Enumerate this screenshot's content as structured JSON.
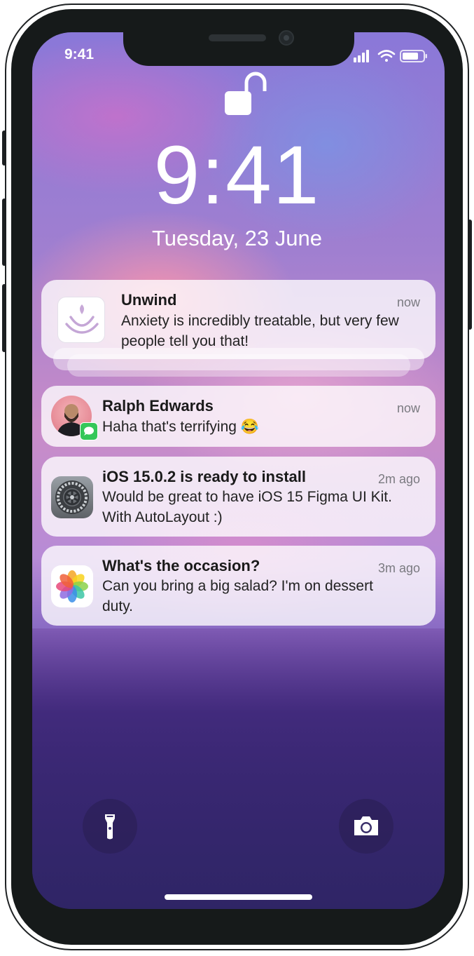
{
  "status_bar": {
    "time": "9:41",
    "icons": [
      "signal-bars-icon",
      "wifi-icon",
      "battery-icon"
    ]
  },
  "lock_screen": {
    "lock_icon": "unlocked-padlock-icon",
    "time": "9:41",
    "date": "Tuesday,  23 June"
  },
  "notifications": [
    {
      "app_icon": "unwind-app-icon",
      "title": "Unwind",
      "body": "Anxiety is incredibly treatable, but very few people tell you that!",
      "time": "now",
      "stacked": true
    },
    {
      "app_icon": "avatar-with-messages-badge",
      "title": "Ralph Edwards",
      "body": "Haha that's terrifying 😂",
      "time": "now"
    },
    {
      "app_icon": "settings-gear-icon",
      "title": "iOS 15.0.2 is ready to install",
      "body": "Would be great to have iOS 15 Figma UI Kit. With AutoLayout :)",
      "time": "2m ago"
    },
    {
      "app_icon": "photos-flower-icon",
      "title": "What's the occasion?",
      "body": "Can you bring a big salad? I'm on dessert duty.",
      "time": "3m ago"
    }
  ],
  "bottom_controls": {
    "left": "flashlight-icon",
    "right": "camera-icon"
  },
  "colors": {
    "frame": "#161a1a",
    "notification_bg": "#ffffff",
    "messages_green": "#34c759"
  }
}
